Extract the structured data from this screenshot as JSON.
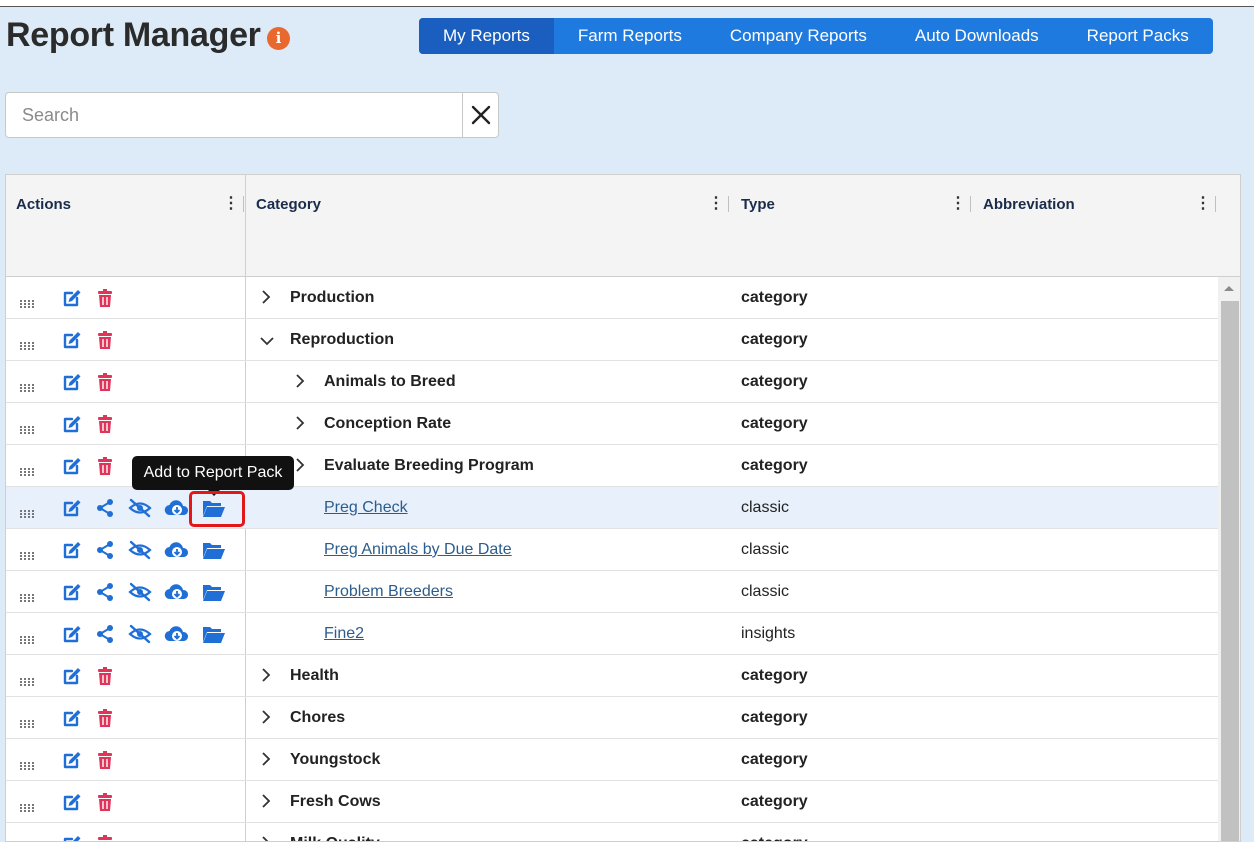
{
  "page": {
    "title": "Report Manager"
  },
  "tabs": [
    {
      "label": "My Reports",
      "active": true
    },
    {
      "label": "Farm Reports",
      "active": false
    },
    {
      "label": "Company Reports",
      "active": false
    },
    {
      "label": "Auto Downloads",
      "active": false
    },
    {
      "label": "Report Packs",
      "active": false
    }
  ],
  "search": {
    "placeholder": "Search",
    "value": ""
  },
  "grid": {
    "columns": [
      {
        "label": "Actions"
      },
      {
        "label": "Category"
      },
      {
        "label": "Type"
      },
      {
        "label": "Abbreviation"
      }
    ],
    "rows": [
      {
        "kind": "category",
        "level": 0,
        "expanded": false,
        "label": "Production",
        "type": "category"
      },
      {
        "kind": "category",
        "level": 0,
        "expanded": true,
        "label": "Reproduction",
        "type": "category"
      },
      {
        "kind": "category",
        "level": 1,
        "expanded": false,
        "label": "Animals to Breed",
        "type": "category"
      },
      {
        "kind": "category",
        "level": 1,
        "expanded": false,
        "label": "Conception Rate",
        "type": "category"
      },
      {
        "kind": "category",
        "level": 1,
        "expanded": false,
        "label": "Evaluate Breeding Program",
        "type": "category"
      },
      {
        "kind": "report",
        "level": 2,
        "label": "Preg Check",
        "type": "classic",
        "highlighted": true
      },
      {
        "kind": "report",
        "level": 2,
        "label": "Preg Animals by Due Date",
        "type": "classic"
      },
      {
        "kind": "report",
        "level": 2,
        "label": "Problem Breeders",
        "type": "classic"
      },
      {
        "kind": "report",
        "level": 2,
        "label": "Fine2",
        "type": "insights"
      },
      {
        "kind": "category",
        "level": 0,
        "expanded": false,
        "label": "Health",
        "type": "category"
      },
      {
        "kind": "category",
        "level": 0,
        "expanded": false,
        "label": "Chores",
        "type": "category"
      },
      {
        "kind": "category",
        "level": 0,
        "expanded": false,
        "label": "Youngstock",
        "type": "category"
      },
      {
        "kind": "category",
        "level": 0,
        "expanded": false,
        "label": "Fresh Cows",
        "type": "category"
      },
      {
        "kind": "category",
        "level": 0,
        "expanded": false,
        "label": "Milk Quality",
        "type": "category"
      }
    ]
  },
  "tooltip": {
    "text": "Add to Report Pack"
  },
  "colors": {
    "primary": "#1f7ae0",
    "tab_active": "#1a5fc0",
    "delete": "#e0355a",
    "icon": "#1f6fd6",
    "info": "#e8682e",
    "focus": "#e01818"
  }
}
